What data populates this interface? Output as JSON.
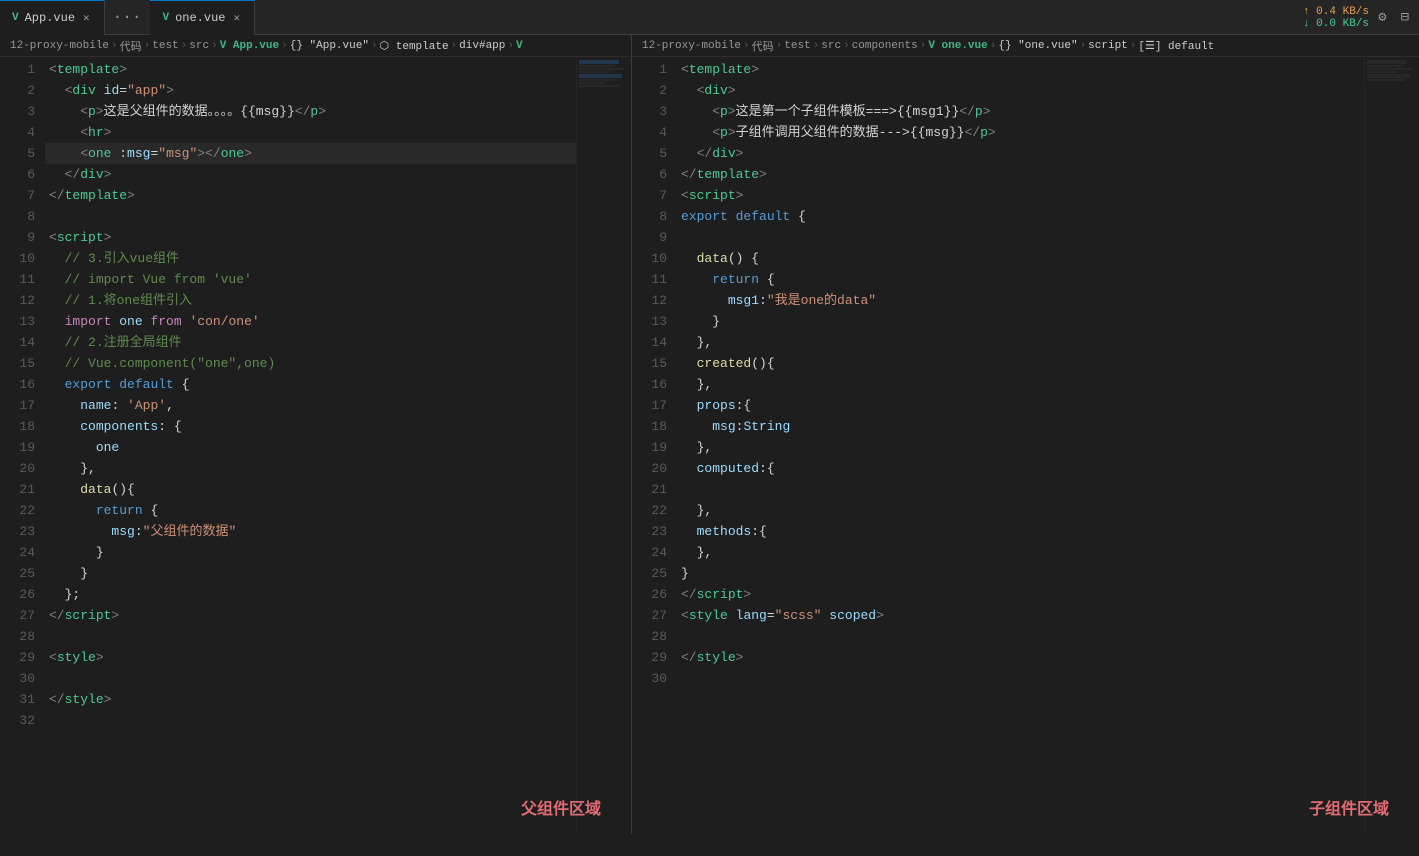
{
  "tabs": {
    "left": {
      "label": "App.vue",
      "icon": "V",
      "active": true,
      "more": "···"
    },
    "right": {
      "label": "one.vue",
      "icon": "V",
      "active": true
    }
  },
  "network": {
    "up_label": "↑ 0.4 KB/s",
    "down_label": "↓ 0.0 KB/s"
  },
  "breadcrumbs": {
    "left": "12-proxy-mobile › 代码 › test › src › V App.vue › {} \"App.vue\" › ⬡ template › div#app › V",
    "right": "12-proxy-mobile › 代码 › test › src › components › V one.vue › {} \"one.vue\" › script › [☰] default"
  },
  "annotations": {
    "left": "父组件区域",
    "right": "子组件区域"
  },
  "left_code_lines": [
    {
      "num": 1,
      "html": "<span class='c-tag'>&lt;</span><span class='c-tagname'>template</span><span class='c-tag'>&gt;</span>"
    },
    {
      "num": 2,
      "html": "  <span class='c-tag'>&lt;</span><span class='c-tagname'>div</span> <span class='c-attr'>id</span><span class='c-text'>=</span><span class='c-string'>\"app\"</span><span class='c-tag'>&gt;</span>"
    },
    {
      "num": 3,
      "html": "    <span class='c-tag'>&lt;</span><span class='c-tagname'>p</span><span class='c-tag'>&gt;</span><span class='c-text'>这是父组件的数据。。。。{{msg}}</span><span class='c-tag'>&lt;/</span><span class='c-tagname'>p</span><span class='c-tag'>&gt;</span>"
    },
    {
      "num": 4,
      "html": "    <span class='c-tag'>&lt;</span><span class='c-tagname'>hr</span><span class='c-tag'>&gt;</span>"
    },
    {
      "num": 5,
      "html": "    <span class='c-tag'>&lt;</span><span class='c-tagname'>one</span> <span class='c-attr'>:msg</span><span class='c-text'>=</span><span class='c-string'>\"msg\"</span><span class='c-tag'>&gt;&lt;/</span><span class='c-tagname'>one</span><span class='c-tag'>&gt;</span>",
      "cursor": true
    },
    {
      "num": 6,
      "html": "  <span class='c-tag'>&lt;/</span><span class='c-tagname'>div</span><span class='c-tag'>&gt;</span>"
    },
    {
      "num": 7,
      "html": "<span class='c-tag'>&lt;/</span><span class='c-tagname'>template</span><span class='c-tag'>&gt;</span>"
    },
    {
      "num": 8,
      "html": ""
    },
    {
      "num": 9,
      "html": "<span class='c-tag'>&lt;</span><span class='c-tagname'>script</span><span class='c-tag'>&gt;</span>"
    },
    {
      "num": 10,
      "html": "  <span class='c-comment'>// 3.引入vue组件</span>"
    },
    {
      "num": 11,
      "html": "  <span class='c-comment'>// import Vue from 'vue'</span>"
    },
    {
      "num": 12,
      "html": "  <span class='c-comment'>// 1.将one组件引入</span>"
    },
    {
      "num": 13,
      "html": "  <span class='c-keyword2'>import</span> <span class='c-varname'>one</span> <span class='c-keyword2'>from</span> <span class='c-string'>'con/one'</span>"
    },
    {
      "num": 14,
      "html": "  <span class='c-comment'>// 2.注册全局组件</span>"
    },
    {
      "num": 15,
      "html": "  <span class='c-comment'>// Vue.component(\"one\",one)</span>"
    },
    {
      "num": 16,
      "html": "  <span class='c-keyword'>export</span> <span class='c-keyword'>default</span> <span class='c-text'>{</span>"
    },
    {
      "num": 17,
      "html": "    <span class='c-prop'>name</span><span class='c-text'>: </span><span class='c-string'>'App'</span><span class='c-text'>,</span>"
    },
    {
      "num": 18,
      "html": "    <span class='c-prop'>components</span><span class='c-text'>: {</span>"
    },
    {
      "num": 19,
      "html": "      <span class='c-varname'>one</span>"
    },
    {
      "num": 20,
      "html": "    <span class='c-text'>},</span>"
    },
    {
      "num": 21,
      "html": "    <span class='c-funcname'>data</span><span class='c-text'>(){</span>"
    },
    {
      "num": 22,
      "html": "      <span class='c-keyword'>return</span> <span class='c-text'>{</span>"
    },
    {
      "num": 23,
      "html": "        <span class='c-prop'>msg</span><span class='c-text'>:</span><span class='c-string'>\"父组件的数据\"</span>"
    },
    {
      "num": 24,
      "html": "      <span class='c-text'>}</span>"
    },
    {
      "num": 25,
      "html": "    <span class='c-text'>}</span>"
    },
    {
      "num": 26,
      "html": "  <span class='c-text'>};</span>"
    },
    {
      "num": 27,
      "html": "<span class='c-tag'>&lt;/</span><span class='c-tagname'>script</span><span class='c-tag'>&gt;</span>"
    },
    {
      "num": 28,
      "html": ""
    },
    {
      "num": 29,
      "html": "<span class='c-tag'>&lt;</span><span class='c-tagname'>style</span><span class='c-tag'>&gt;</span>"
    },
    {
      "num": 30,
      "html": ""
    },
    {
      "num": 31,
      "html": "<span class='c-tag'>&lt;/</span><span class='c-tagname'>style</span><span class='c-tag'>&gt;</span>"
    },
    {
      "num": 32,
      "html": ""
    }
  ],
  "right_code_lines": [
    {
      "num": 1,
      "html": "<span class='c-tag'>&lt;</span><span class='c-tagname'>template</span><span class='c-tag'>&gt;</span>"
    },
    {
      "num": 2,
      "html": "  <span class='c-tag'>&lt;</span><span class='c-tagname'>div</span><span class='c-tag'>&gt;</span>"
    },
    {
      "num": 3,
      "html": "    <span class='c-tag'>&lt;</span><span class='c-tagname'>p</span><span class='c-tag'>&gt;</span><span class='c-text'>这是第一个子组件模板===&gt;{{msg1}}</span><span class='c-tag'>&lt;/</span><span class='c-tagname'>p</span><span class='c-tag'>&gt;</span>"
    },
    {
      "num": 4,
      "html": "    <span class='c-tag'>&lt;</span><span class='c-tagname'>p</span><span class='c-tag'>&gt;</span><span class='c-text'>子组件调用父组件的数据---&gt;{{msg}}</span><span class='c-tag'>&lt;/</span><span class='c-tagname'>p</span><span class='c-tag'>&gt;</span>"
    },
    {
      "num": 5,
      "html": "  <span class='c-tag'>&lt;/</span><span class='c-tagname'>div</span><span class='c-tag'>&gt;</span>"
    },
    {
      "num": 6,
      "html": "<span class='c-tag'>&lt;/</span><span class='c-tagname'>template</span><span class='c-tag'>&gt;</span>"
    },
    {
      "num": 7,
      "html": "<span class='c-tag'>&lt;</span><span class='c-tagname'>script</span><span class='c-tag'>&gt;</span>"
    },
    {
      "num": 8,
      "html": "<span class='c-keyword'>export</span> <span class='c-keyword'>default</span> <span class='c-text'>{</span>"
    },
    {
      "num": 9,
      "html": ""
    },
    {
      "num": 10,
      "html": "  <span class='c-funcname'>data</span><span class='c-text'>() {</span>"
    },
    {
      "num": 11,
      "html": "    <span class='c-keyword'>return</span> <span class='c-text'>{</span>"
    },
    {
      "num": 12,
      "html": "      <span class='c-prop'>msg1</span><span class='c-text'>:</span><span class='c-string'>\"我是one的data\"</span>"
    },
    {
      "num": 13,
      "html": "    <span class='c-text'>}</span>"
    },
    {
      "num": 14,
      "html": "  <span class='c-text'>},</span>"
    },
    {
      "num": 15,
      "html": "  <span class='c-funcname'>created</span><span class='c-text'>(){</span>"
    },
    {
      "num": 16,
      "html": "  <span class='c-text'>},</span>"
    },
    {
      "num": 17,
      "html": "  <span class='c-prop'>props</span><span class='c-text'>:{</span>"
    },
    {
      "num": 18,
      "html": "    <span class='c-prop'>msg</span><span class='c-text'>:</span><span class='c-varname'>String</span>"
    },
    {
      "num": 19,
      "html": "  <span class='c-text'>},</span>"
    },
    {
      "num": 20,
      "html": "  <span class='c-prop'>computed</span><span class='c-text'>:{</span>"
    },
    {
      "num": 21,
      "html": ""
    },
    {
      "num": 22,
      "html": "  <span class='c-text'>},</span>"
    },
    {
      "num": 23,
      "html": "  <span class='c-prop'>methods</span><span class='c-text'>:{</span>"
    },
    {
      "num": 24,
      "html": "  <span class='c-text'>},</span>"
    },
    {
      "num": 25,
      "html": "<span class='c-text'>}</span>"
    },
    {
      "num": 26,
      "html": "<span class='c-tag'>&lt;/</span><span class='c-tagname'>script</span><span class='c-tag'>&gt;</span>"
    },
    {
      "num": 27,
      "html": "<span class='c-tag'>&lt;</span><span class='c-tagname'>style</span> <span class='c-attr'>lang</span><span class='c-text'>=</span><span class='c-string'>\"scss\"</span> <span class='c-attr'>scoped</span><span class='c-tag'>&gt;</span>"
    },
    {
      "num": 28,
      "html": ""
    },
    {
      "num": 29,
      "html": "<span class='c-tag'>&lt;/</span><span class='c-tagname'>style</span><span class='c-tag'>&gt;</span>"
    },
    {
      "num": 30,
      "html": ""
    }
  ]
}
